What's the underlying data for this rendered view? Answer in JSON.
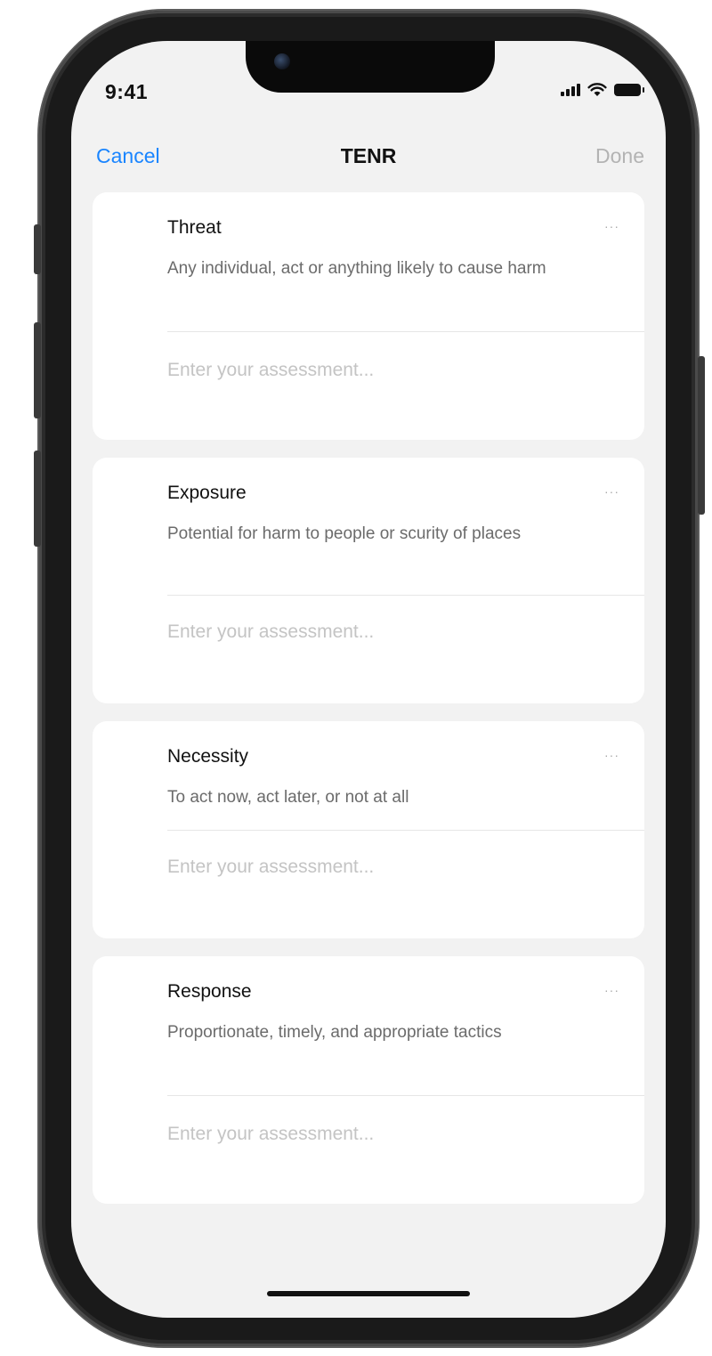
{
  "status_bar": {
    "time": "9:41",
    "icons": [
      "cellular-signal-icon",
      "wifi-icon",
      "battery-icon"
    ]
  },
  "nav": {
    "cancel_label": "Cancel",
    "title": "TENR",
    "done_label": "Done"
  },
  "cards": [
    {
      "title": "Threat",
      "description": "Any individual, act or anything likely to cause harm",
      "more_label": "···",
      "placeholder": "Enter your assessment..."
    },
    {
      "title": "Exposure",
      "description": "Potential for harm to people or scurity of places",
      "more_label": "···",
      "placeholder": "Enter your assessment..."
    },
    {
      "title": "Necessity",
      "description": "To act now, act later, or not at all",
      "more_label": "···",
      "placeholder": "Enter your assessment..."
    },
    {
      "title": "Response",
      "description": "Proportionate, timely, and appropriate tactics",
      "more_label": "···",
      "placeholder": "Enter your assessment..."
    }
  ],
  "colors": {
    "accent": "#1a85ff",
    "disabled": "#b3b3b3",
    "background": "#f2f2f2",
    "card": "#ffffff"
  }
}
